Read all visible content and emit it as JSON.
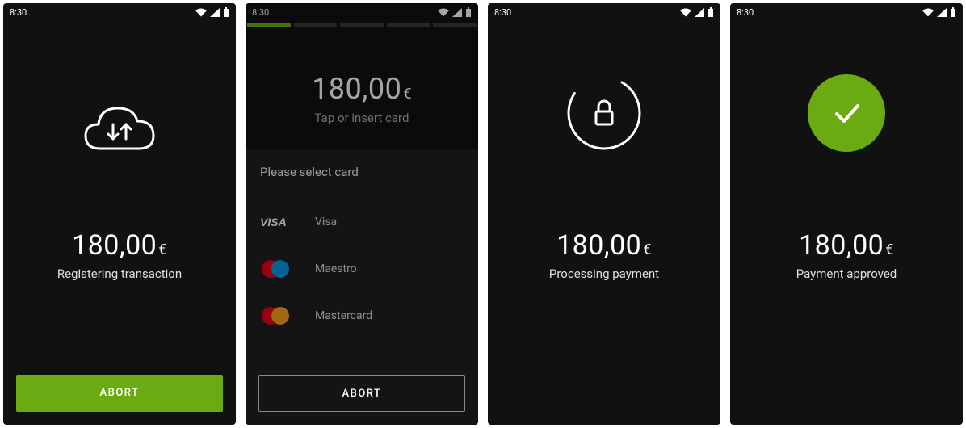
{
  "statusbar": {
    "time": "8:30"
  },
  "colors": {
    "accent": "#6aab11",
    "bg": "#111111"
  },
  "screen1": {
    "amount": "180,00",
    "currency": "€",
    "status": "Registering transaction",
    "abort_label": "ABORT"
  },
  "screen2": {
    "amount": "180,00",
    "currency": "€",
    "hint": "Tap or insert card",
    "panel_title": "Please select card",
    "cards": [
      {
        "name": "Visa"
      },
      {
        "name": "Maestro"
      },
      {
        "name": "Mastercard"
      }
    ],
    "abort_label": "ABORT",
    "progress": {
      "segments": 5,
      "active": 0
    }
  },
  "screen3": {
    "amount": "180,00",
    "currency": "€",
    "status": "Processing payment"
  },
  "screen4": {
    "amount": "180,00",
    "currency": "€",
    "status": "Payment approved"
  }
}
